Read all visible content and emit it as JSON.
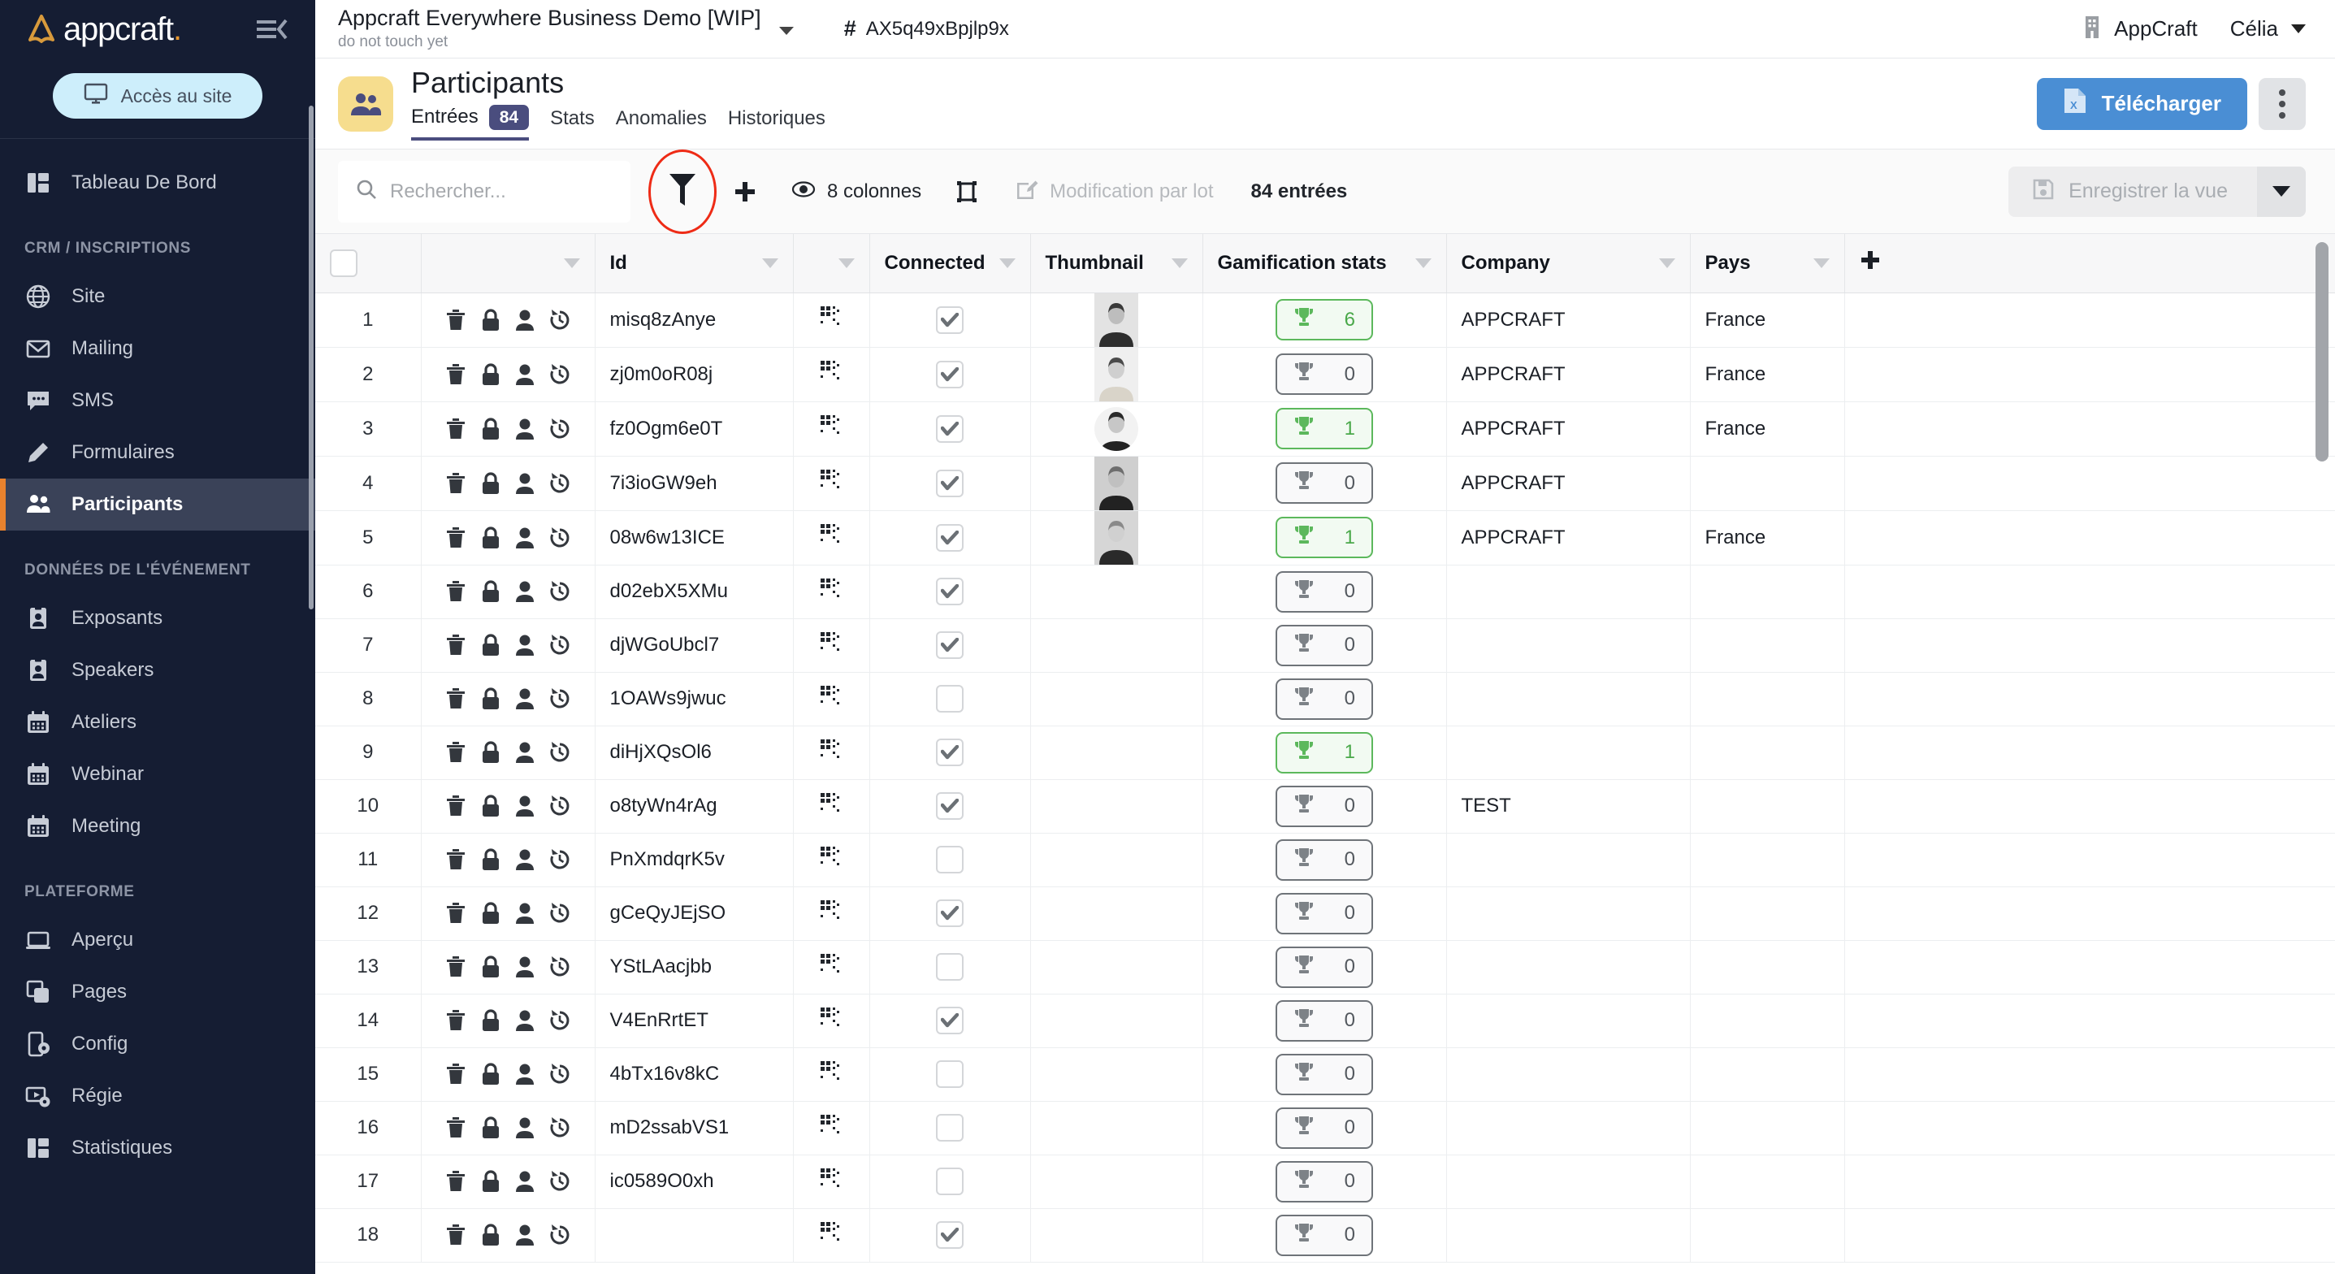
{
  "brand": {
    "logo_text": "appcraft",
    "logo_dot": ".",
    "accent_orange": "#e8822e",
    "sidebar_bg": "#151d33",
    "primary_blue": "#4a8ed4"
  },
  "sidebar": {
    "site_button": "Accès au site",
    "groups": [
      {
        "section": null,
        "items": [
          {
            "label": "Tableau De Bord",
            "icon": "dashboard-icon",
            "active": false
          }
        ]
      },
      {
        "section": "CRM / INSCRIPTIONS",
        "items": [
          {
            "label": "Site",
            "icon": "globe-icon",
            "active": false
          },
          {
            "label": "Mailing",
            "icon": "envelope-icon",
            "active": false
          },
          {
            "label": "SMS",
            "icon": "chat-icon",
            "active": false
          },
          {
            "label": "Formulaires",
            "icon": "pencil-icon",
            "active": false
          },
          {
            "label": "Participants",
            "icon": "people-icon",
            "active": true
          }
        ]
      },
      {
        "section": "DONNÉES DE L'ÉVÉNEMENT",
        "items": [
          {
            "label": "Exposants",
            "icon": "badge-icon",
            "active": false
          },
          {
            "label": "Speakers",
            "icon": "badge-icon",
            "active": false
          },
          {
            "label": "Ateliers",
            "icon": "calendar-icon",
            "active": false
          },
          {
            "label": "Webinar",
            "icon": "calendar-icon",
            "active": false
          },
          {
            "label": "Meeting",
            "icon": "calendar-icon",
            "active": false
          }
        ]
      },
      {
        "section": "PLATEFORME",
        "items": [
          {
            "label": "Aperçu",
            "icon": "laptop-icon",
            "active": false
          },
          {
            "label": "Pages",
            "icon": "copy-icon",
            "active": false
          },
          {
            "label": "Config",
            "icon": "phone-gear-icon",
            "active": false
          },
          {
            "label": "Régie",
            "icon": "video-gear-icon",
            "active": false
          },
          {
            "label": "Statistiques",
            "icon": "dashboard-icon",
            "active": false
          }
        ]
      }
    ]
  },
  "topbar": {
    "project_title": "Appcraft Everywhere Business Demo [WIP]",
    "project_subtitle": "do not touch yet",
    "hash_symbol": "#",
    "project_id": "AX5q49xBpjlp9x",
    "org_name": "AppCraft",
    "user_name": "Célia"
  },
  "page": {
    "title": "Participants",
    "tabs": [
      {
        "label": "Entrées",
        "badge": "84",
        "active": true
      },
      {
        "label": "Stats",
        "badge": null,
        "active": false
      },
      {
        "label": "Anomalies",
        "badge": null,
        "active": false
      },
      {
        "label": "Historiques",
        "badge": null,
        "active": false
      }
    ],
    "download_label": "Télécharger"
  },
  "toolbar": {
    "search_placeholder": "Rechercher...",
    "columns_label": "8 colonnes",
    "batch_edit_label": "Modification par lot",
    "entries_label": "84 entrées",
    "save_view_label": "Enregistrer la vue",
    "annotation": {
      "shape": "ellipse",
      "color": "#ee2b16",
      "target": "filter-icon"
    }
  },
  "table": {
    "columns": [
      {
        "key": "select",
        "label": "",
        "sortable": false
      },
      {
        "key": "actions",
        "label": "",
        "sortable": true
      },
      {
        "key": "id",
        "label": "Id",
        "sortable": true
      },
      {
        "key": "qr",
        "label": "",
        "sortable": true
      },
      {
        "key": "connected",
        "label": "Connected",
        "sortable": true
      },
      {
        "key": "thumbnail",
        "label": "Thumbnail",
        "sortable": true
      },
      {
        "key": "gamif",
        "label": "Gamification stats",
        "sortable": true
      },
      {
        "key": "company",
        "label": "Company",
        "sortable": true
      },
      {
        "key": "pays",
        "label": "Pays",
        "sortable": true
      },
      {
        "key": "add",
        "label": "",
        "sortable": false
      }
    ],
    "rows": [
      {
        "n": "1",
        "id": "misq8zAnye",
        "connected": true,
        "thumb": true,
        "gamif": "6",
        "company": "APPCRAFT",
        "pays": "France"
      },
      {
        "n": "2",
        "id": "zj0m0oR08j",
        "connected": true,
        "thumb": true,
        "gamif": "0",
        "company": "APPCRAFT",
        "pays": "France"
      },
      {
        "n": "3",
        "id": "fz0Ogm6e0T",
        "connected": true,
        "thumb": true,
        "gamif": "1",
        "company": "APPCRAFT",
        "pays": "France"
      },
      {
        "n": "4",
        "id": "7i3ioGW9eh",
        "connected": true,
        "thumb": true,
        "gamif": "0",
        "company": "APPCRAFT",
        "pays": ""
      },
      {
        "n": "5",
        "id": "08w6w13ICE",
        "connected": true,
        "thumb": true,
        "gamif": "1",
        "company": "APPCRAFT",
        "pays": "France"
      },
      {
        "n": "6",
        "id": "d02ebX5XMu",
        "connected": true,
        "thumb": false,
        "gamif": "0",
        "company": "",
        "pays": ""
      },
      {
        "n": "7",
        "id": "djWGoUbcl7",
        "connected": true,
        "thumb": false,
        "gamif": "0",
        "company": "",
        "pays": ""
      },
      {
        "n": "8",
        "id": "1OAWs9jwuc",
        "connected": false,
        "thumb": false,
        "gamif": "0",
        "company": "",
        "pays": ""
      },
      {
        "n": "9",
        "id": "diHjXQsOl6",
        "connected": true,
        "thumb": false,
        "gamif": "1",
        "company": "",
        "pays": ""
      },
      {
        "n": "10",
        "id": "o8tyWn4rAg",
        "connected": true,
        "thumb": false,
        "gamif": "0",
        "company": "TEST",
        "pays": ""
      },
      {
        "n": "11",
        "id": "PnXmdqrK5v",
        "connected": false,
        "thumb": false,
        "gamif": "0",
        "company": "",
        "pays": ""
      },
      {
        "n": "12",
        "id": "gCeQyJEjSO",
        "connected": true,
        "thumb": false,
        "gamif": "0",
        "company": "",
        "pays": ""
      },
      {
        "n": "13",
        "id": "YStLAacjbb",
        "connected": false,
        "thumb": false,
        "gamif": "0",
        "company": "",
        "pays": ""
      },
      {
        "n": "14",
        "id": "V4EnRrtET",
        "connected": true,
        "thumb": false,
        "gamif": "0",
        "company": "",
        "pays": ""
      },
      {
        "n": "15",
        "id": "4bTx16v8kC",
        "connected": false,
        "thumb": false,
        "gamif": "0",
        "company": "",
        "pays": ""
      },
      {
        "n": "16",
        "id": "mD2ssabVS1",
        "connected": false,
        "thumb": false,
        "gamif": "0",
        "company": "",
        "pays": ""
      },
      {
        "n": "17",
        "id": "ic0589O0xh",
        "connected": false,
        "thumb": false,
        "gamif": "0",
        "company": "",
        "pays": ""
      },
      {
        "n": "18",
        "id": "",
        "connected": true,
        "thumb": false,
        "gamif": "0",
        "company": "",
        "pays": ""
      }
    ],
    "row_actions": [
      "trash-icon",
      "lock-icon",
      "person-icon",
      "history-icon"
    ]
  }
}
